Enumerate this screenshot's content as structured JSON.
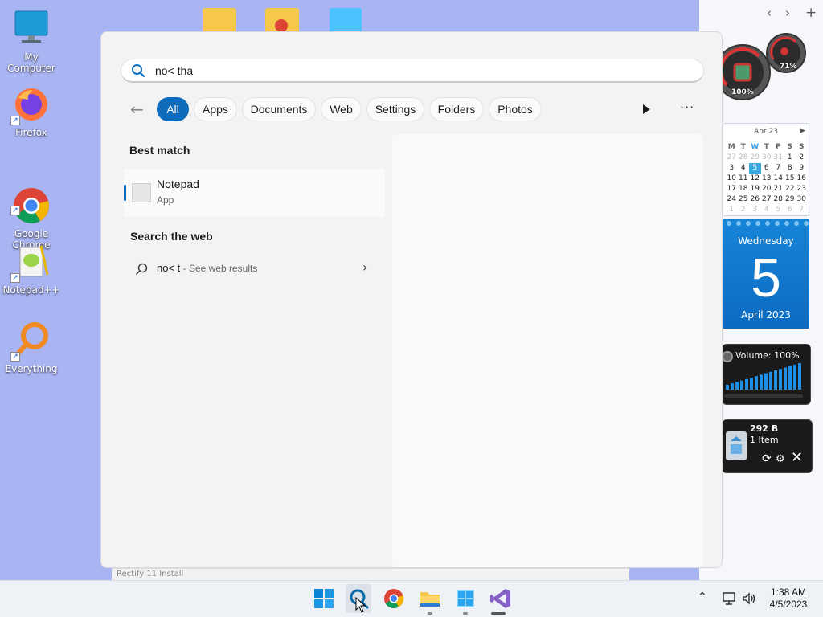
{
  "colors": {
    "accent": "#0f6cbd",
    "desktop": "#a9b4f3",
    "taskbar": "#eef1f6"
  },
  "desktop_icons": [
    {
      "label": "My Computer",
      "icon": "monitor-icon"
    },
    {
      "label": "Firefox",
      "icon": "firefox-icon"
    },
    {
      "label": "Google\nChrome",
      "icon": "chrome-icon"
    },
    {
      "label": "Notepad++",
      "icon": "notepad-plus-plus-icon"
    },
    {
      "label": "Everything",
      "icon": "everything-search-icon"
    }
  ],
  "right_panel": {
    "nav_back": "‹",
    "nav_forward": "›",
    "add": "+"
  },
  "search": {
    "query": "no< tha",
    "filters": [
      "All",
      "Apps",
      "Documents",
      "Web",
      "Settings",
      "Folders",
      "Photos"
    ],
    "active_filter": "All",
    "best_match_heading": "Best match",
    "best_match": {
      "title": "Notepad",
      "subtitle": "App"
    },
    "web_heading": "Search the web",
    "web_result": {
      "query": "no< t",
      "suffix": " - See web results"
    }
  },
  "gadgets": {
    "gauge": {
      "cpu": "100%",
      "memory": "71%"
    },
    "calendar": {
      "month_label": "Apr 23",
      "weekdays": [
        "M",
        "T",
        "W",
        "T",
        "F",
        "S",
        "S"
      ],
      "weeks": [
        [
          "27",
          "28",
          "29",
          "30",
          "31",
          "1",
          "2"
        ],
        [
          "3",
          "4",
          "5",
          "6",
          "7",
          "8",
          "9"
        ],
        [
          "10",
          "11",
          "12",
          "13",
          "14",
          "15",
          "16"
        ],
        [
          "17",
          "18",
          "19",
          "20",
          "21",
          "22",
          "23"
        ],
        [
          "24",
          "25",
          "26",
          "27",
          "28",
          "29",
          "30"
        ],
        [
          "1",
          "2",
          "3",
          "4",
          "5",
          "6",
          "7"
        ]
      ]
    },
    "date": {
      "weekday": "Wednesday",
      "day": "5",
      "month_year": "April 2023"
    },
    "volume": {
      "label": "Volume: 100%",
      "level": 1.0
    },
    "recycle_bin": {
      "size": "292 B",
      "items": "1 Item"
    }
  },
  "taskbar": {
    "behind_window_title": "Rectify 11 Install",
    "clock": {
      "time": "1:38 AM",
      "date": "4/5/2023"
    }
  }
}
